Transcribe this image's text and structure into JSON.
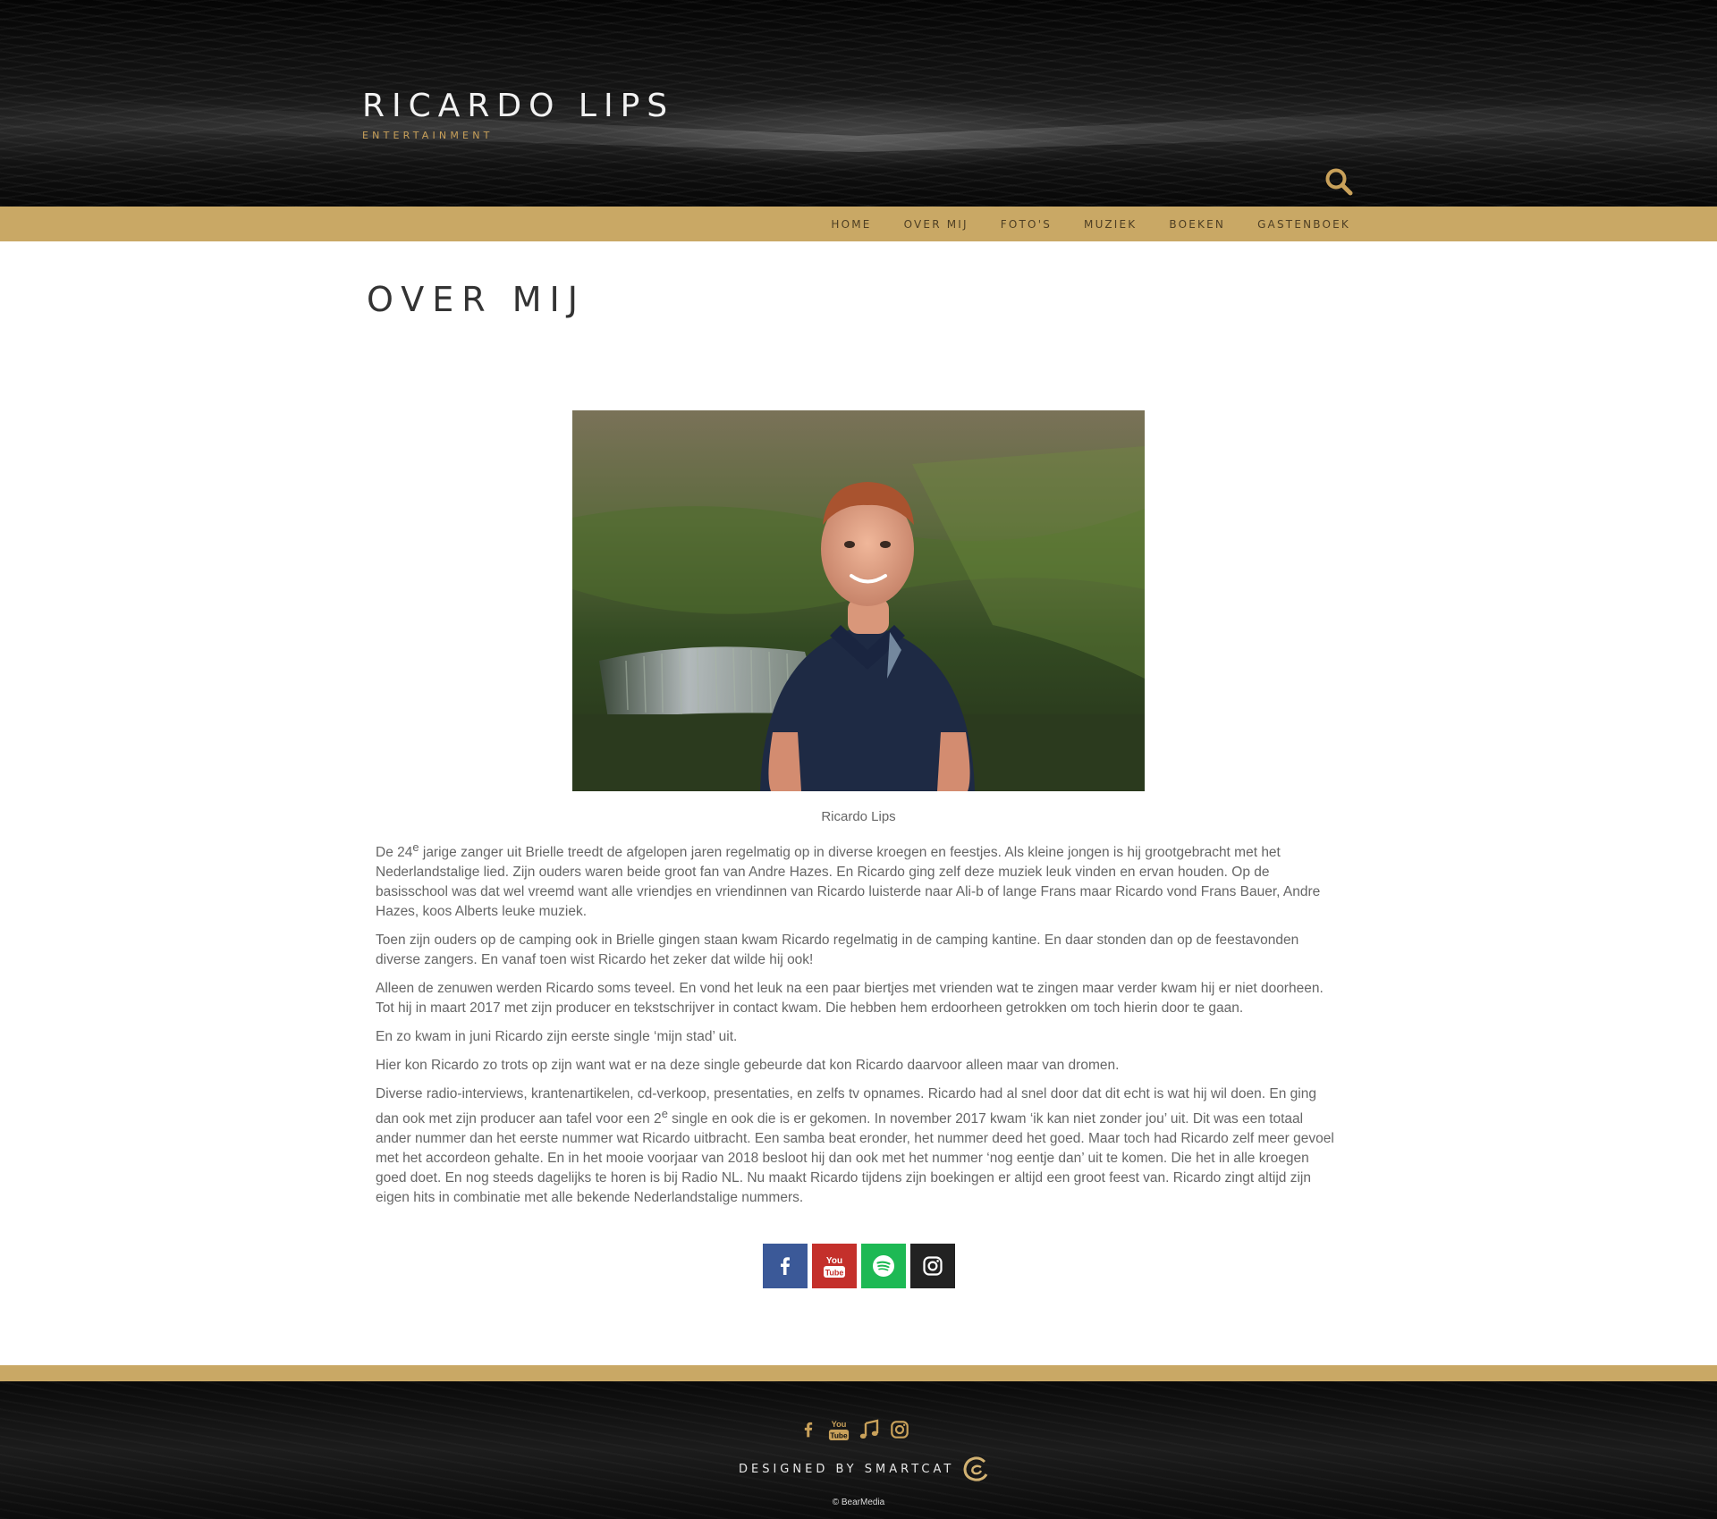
{
  "header": {
    "logo_title": "RICARDO LIPS",
    "logo_subtitle": "ENTERTAINMENT",
    "search_icon": "search-icon"
  },
  "nav": {
    "items": [
      {
        "label": "HOME"
      },
      {
        "label": "OVER MIJ"
      },
      {
        "label": "FOTO'S"
      },
      {
        "label": "MUZIEK"
      },
      {
        "label": "BOEKEN"
      },
      {
        "label": "GASTENBOEK"
      }
    ]
  },
  "main": {
    "page_title": "OVER MIJ",
    "photo_caption": "Ricardo Lips",
    "paragraphs": [
      {
        "pre": "De 24",
        "sup": "e",
        "post": " jarige zanger uit Brielle treedt de afgelopen jaren regelmatig op in diverse kroegen en feestjes. Als kleine jongen is hij grootgebracht met het Nederlandstalige lied. Zijn ouders waren beide groot fan van Andre Hazes. En Ricardo ging zelf deze muziek leuk vinden en ervan houden. Op de basisschool was dat wel vreemd want alle vriendjes en vriendinnen van Ricardo luisterde naar Ali-b of lange Frans maar Ricardo vond Frans Bauer, Andre Hazes, koos Alberts leuke muziek."
      },
      {
        "text": "Toen zijn ouders op de camping ook in Brielle gingen staan kwam Ricardo regelmatig in de camping kantine. En daar stonden dan op de feestavonden diverse zangers. En vanaf toen wist Ricardo het zeker dat wilde hij ook!"
      },
      {
        "text": "Alleen de zenuwen werden Ricardo soms teveel. En vond het leuk na een paar biertjes met vrienden wat te zingen maar verder kwam hij er niet doorheen. Tot hij in maart 2017 met zijn producer en tekstschrijver in contact kwam. Die hebben hem erdoorheen getrokken om toch hierin door te gaan."
      },
      {
        "text": "En zo kwam in juni Ricardo zijn eerste single ‘mijn stad’ uit."
      },
      {
        "text": "Hier kon Ricardo zo trots op zijn want wat er na deze single gebeurde dat kon Ricardo daarvoor alleen maar van dromen."
      },
      {
        "pre": "Diverse radio-interviews, krantenartikelen, cd-verkoop, presentaties, en zelfs tv opnames. Ricardo had al snel door dat dit echt is wat hij wil doen. En ging dan ook met zijn producer aan tafel voor een 2",
        "sup": "e",
        "post": " single en ook die is er gekomen. In november 2017 kwam ‘ik kan niet zonder jou’ uit. Dit was een totaal ander nummer dan het eerste nummer wat Ricardo uitbracht. Een samba beat eronder, het nummer deed het goed. Maar toch had Ricardo zelf meer gevoel met het accordeon gehalte. En in het mooie voorjaar van 2018 besloot hij dan ook met het nummer ‘nog eentje dan’ uit te komen. Die het in alle kroegen goed doet. En nog steeds dagelijks te horen is bij Radio NL. Nu maakt Ricardo tijdens zijn boekingen er altijd een groot feest van. Ricardo zingt altijd zijn eigen hits in combinatie met alle bekende Nederlandstalige nummers."
      }
    ],
    "socials": [
      {
        "icon": "facebook-icon",
        "color": "#3b5998"
      },
      {
        "icon": "youtube-icon",
        "color": "#c4302b",
        "glyph_top": "You",
        "glyph_bottom": "Tube"
      },
      {
        "icon": "spotify-icon",
        "color": "#1db954"
      },
      {
        "icon": "instagram-icon",
        "color": "#222222"
      }
    ]
  },
  "footer": {
    "icons": [
      {
        "icon": "facebook-icon"
      },
      {
        "icon": "youtube-icon",
        "glyph_top": "You",
        "glyph_bottom": "Tube"
      },
      {
        "icon": "music-note-icon"
      },
      {
        "icon": "instagram-icon"
      }
    ],
    "designed_by": "DESIGNED BY SMARTCAT",
    "copyright": "© BearMedia",
    "accent_color": "#c9a865"
  }
}
